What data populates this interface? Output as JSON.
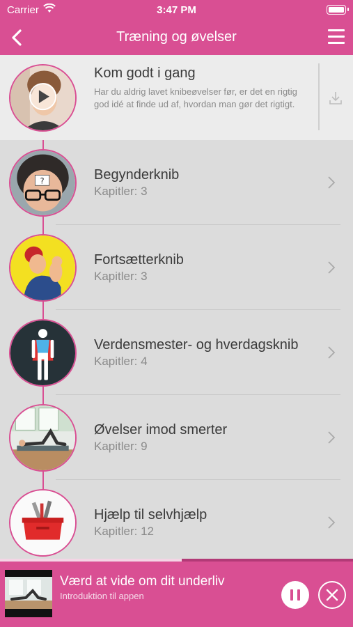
{
  "status_bar": {
    "carrier": "Carrier",
    "time": "3:47 PM"
  },
  "header": {
    "title": "Træning og øvelser",
    "back_icon": "chevron-left-icon",
    "menu_icon": "hamburger-menu-icon"
  },
  "items": [
    {
      "title": "Kom godt i gang",
      "description": "Har du aldrig lavet knibeøvelser før, er det en rigtig god idé at finde ud af, hvordan man gør det rigtigt.",
      "image": "woman-portrait-video-thumbnail",
      "action_icon": "download-icon"
    },
    {
      "title": "Begynderknib",
      "subtitle": "Kapitler: 3",
      "image": "woman-with-question-mark"
    },
    {
      "title": "Fortsætterknib",
      "subtitle": "Kapitler: 3",
      "image": "we-can-do-it-poster"
    },
    {
      "title": "Verdensmester- og hverdagsknib",
      "subtitle": "Kapitler: 4",
      "image": "superhero-figure"
    },
    {
      "title": "Øvelser imod smerter",
      "subtitle": "Kapitler: 9",
      "image": "woman-doing-floor-exercise"
    },
    {
      "title": "Hjælp til selvhjælp",
      "subtitle": "Kapitler: 12",
      "image": "red-toolbox"
    }
  ],
  "player": {
    "title": "Værd at vide om dit underliv",
    "subtitle": "Introduktion til appen",
    "progress": 0.515,
    "thumbnail": "exercise-video-thumbnail",
    "pause_icon": "pause-icon",
    "close_icon": "close-icon"
  },
  "colors": {
    "accent": "#d94f93",
    "background": "#dcdcdc"
  }
}
